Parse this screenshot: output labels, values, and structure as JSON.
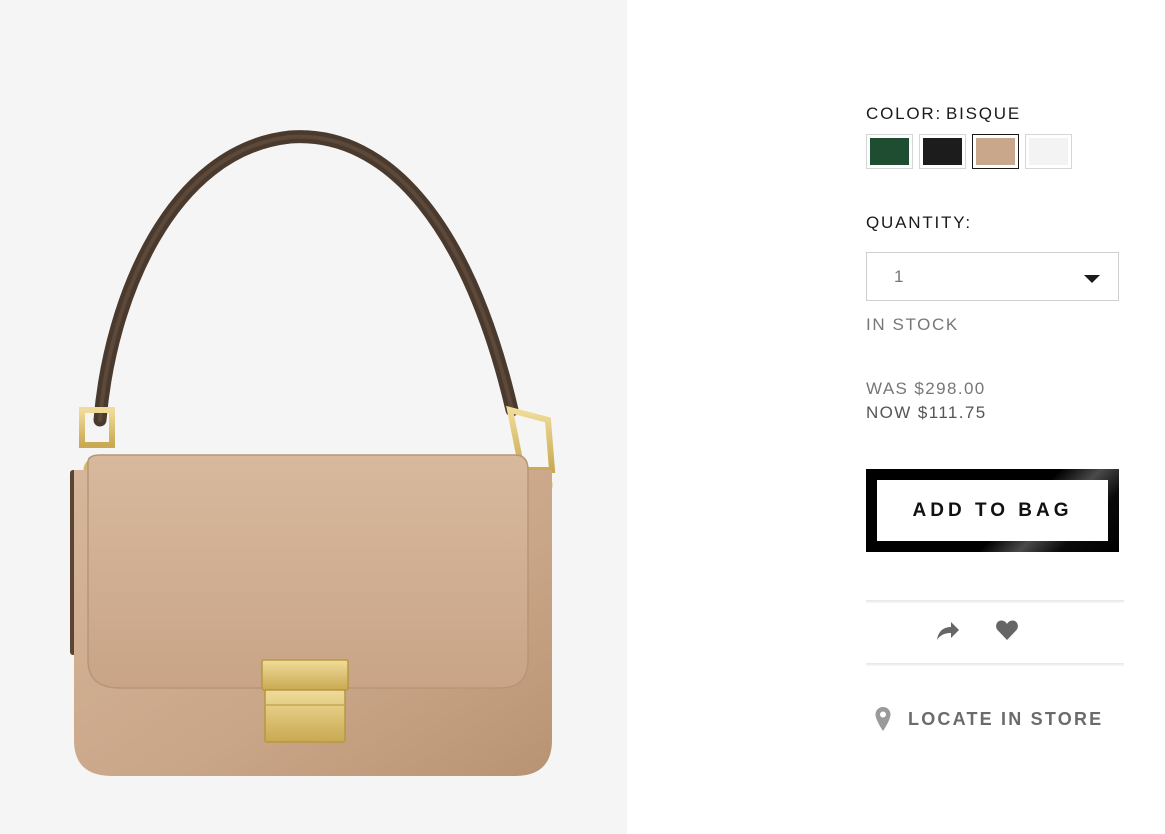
{
  "product_image": {
    "alt_icon": "handbag-image"
  },
  "color": {
    "label": "COLOR:",
    "selected": "BISQUE",
    "swatches": [
      {
        "name": "green",
        "hex": "#1e4d32"
      },
      {
        "name": "black",
        "hex": "#1c1c1c"
      },
      {
        "name": "bisque",
        "hex": "#c9a78a"
      },
      {
        "name": "white",
        "hex": "#f3f3f3"
      }
    ]
  },
  "quantity": {
    "label": "QUANTITY:",
    "value": "1"
  },
  "stock_status": "IN STOCK",
  "pricing": {
    "was": "WAS $298.00",
    "now": "NOW $111.75"
  },
  "add_to_bag_label": "ADD TO BAG",
  "actions": {
    "share_icon": "share-arrow-icon",
    "wishlist_icon": "heart-icon"
  },
  "locate_in_store_label": "LOCATE IN STORE"
}
